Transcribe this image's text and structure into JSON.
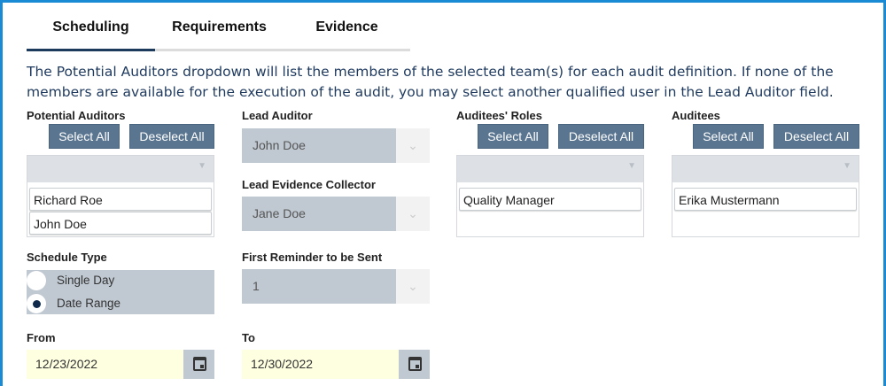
{
  "tabs": [
    "Scheduling",
    "Requirements",
    "Evidence"
  ],
  "info": "The Potential Auditors dropdown will list the members of the selected team(s) for each audit definition. If none of the members are available for the execution of the audit, you may select another qualified user in the Lead Auditor field.",
  "potential_auditors": {
    "label": "Potential Auditors",
    "select_all": "Select All",
    "deselect_all": "Deselect All",
    "items": [
      "Richard Roe",
      "John Doe"
    ]
  },
  "lead_auditor": {
    "label": "Lead Auditor",
    "value": "John Doe"
  },
  "lead_evidence_collector": {
    "label": "Lead Evidence Collector",
    "value": "Jane Doe"
  },
  "auditees_roles": {
    "label": "Auditees' Roles",
    "select_all": "Select All",
    "deselect_all": "Deselect All",
    "items": [
      "Quality Manager"
    ]
  },
  "auditees": {
    "label": "Auditees",
    "select_all": "Select All",
    "deselect_all": "Deselect All",
    "items": [
      "Erika Mustermann"
    ]
  },
  "schedule_type": {
    "label": "Schedule Type",
    "options": [
      "Single Day",
      "Date Range"
    ],
    "selected": "Date Range"
  },
  "first_reminder": {
    "label": "First Reminder to be Sent",
    "value": "1"
  },
  "from": {
    "label": "From",
    "value": "12/23/2022"
  },
  "to": {
    "label": "To",
    "value": "12/30/2022"
  }
}
